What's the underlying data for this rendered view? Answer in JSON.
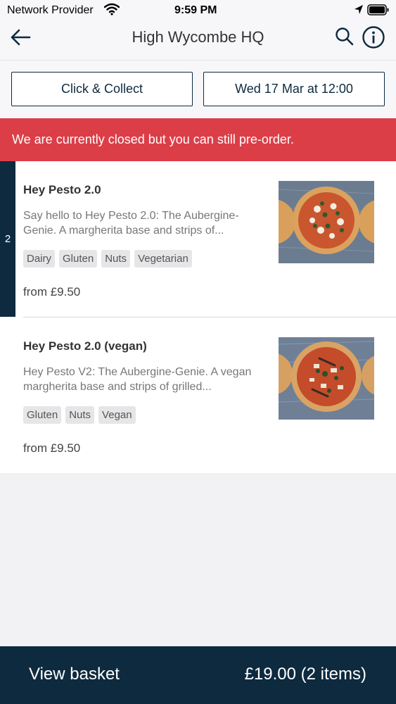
{
  "status_bar": {
    "carrier": "Network Provider",
    "time": "9:59 PM"
  },
  "nav": {
    "title": "High Wycombe HQ"
  },
  "selectors": {
    "fulfilment": "Click & Collect",
    "date": "Wed 17 Mar at 12:00"
  },
  "banner": {
    "message": "We are currently closed but you can still pre-order."
  },
  "menu": {
    "items": [
      {
        "quantity": "2",
        "name": "Hey Pesto 2.0",
        "description": "Say hello to Hey Pesto 2.0: The Aubergine-Genie. A margherita base and strips of...",
        "tags": [
          "Dairy",
          "Gluten",
          "Nuts",
          "Vegetarian"
        ],
        "price": "from £9.50"
      },
      {
        "name": "Hey Pesto 2.0 (vegan)",
        "description": "Hey Pesto V2: The Aubergine-Genie. A vegan margherita base and strips of grilled...",
        "tags": [
          "Gluten",
          "Nuts",
          "Vegan"
        ],
        "price": "from £9.50"
      }
    ]
  },
  "footer": {
    "basket_label": "View basket",
    "basket_total": "£19.00 (2 items)"
  },
  "colors": {
    "navy": "#0d2a3f",
    "banner_red": "#dc3e48"
  }
}
